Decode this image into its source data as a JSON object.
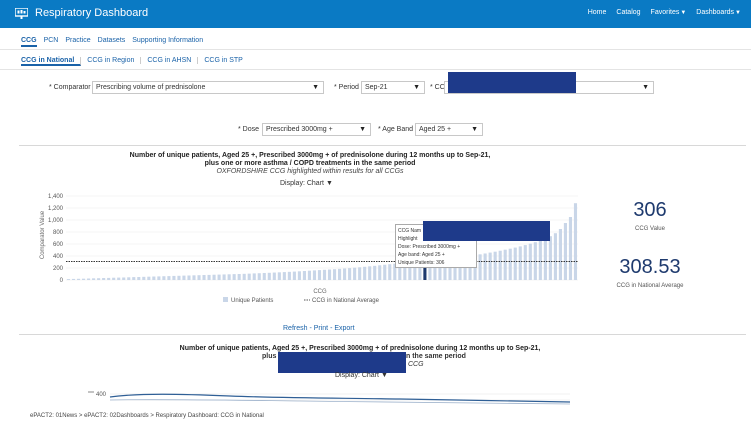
{
  "header": {
    "title": "Respiratory Dashboard",
    "nav": [
      "Home",
      "Catalog",
      "Favorites",
      "Dashboards"
    ]
  },
  "tabs": [
    "CCG",
    "PCN",
    "Practice",
    "Datasets",
    "Supporting Information"
  ],
  "subtabs": [
    "CCG in National",
    "CCG in Region",
    "CCG in AHSN",
    "CCG in STP"
  ],
  "filters": {
    "comparator_label": "* Comparator",
    "comparator_value": "Prescribing volume of prednisolone",
    "period_label": "* Period",
    "period_value": "Sep-21",
    "ccg_label": "* CC",
    "dose_label": "* Dose",
    "dose_value": "Prescribed 3000mg +",
    "age_label": "* Age Band",
    "age_value": "Aged 25 +"
  },
  "chart1": {
    "title_line1": "Number of unique patients, Aged 25 +, Prescribed 3000mg + of prednisolone during 12 months up to Sep-21,",
    "title_line2": "plus one or more asthma / COPD treatments in the same period",
    "subtitle": "OXFORDSHIRE CCG highlighted within results for all CCGs",
    "display_label": "Display:",
    "display_value": "Chart",
    "tooltip": {
      "line1": "CCG Nam",
      "line2": "Highlight",
      "line3": "Dose: Prescribed 3000mg +",
      "line4": "Age band: Aged 25 +",
      "line5": "Unique Patients: 306"
    },
    "links": "Refresh - Print - Export"
  },
  "kpis": {
    "ccg_value": "306",
    "ccg_value_label": "CCG Value",
    "national_avg": "308.53",
    "national_avg_label": "CCG in National Average"
  },
  "chart2": {
    "title_line1": "Number of unique patients, Aged 25 +, Prescribed 3000mg + of prednisolone during 12 months up to Sep-21,",
    "title_line2_left": "plus",
    "title_line2_right": "n the same period",
    "subtitle_right": "CCG",
    "display_label": "Display:",
    "display_value": "Chart",
    "tick_400": "400"
  },
  "breadcrumb": "ePACT2: 01News > ePACT2: 02Dashboards > Respiratory Dashboard: CCG in National",
  "chart_data": {
    "type": "bar",
    "title": "Number of unique patients, Aged 25 +, Prescribed 3000mg + of prednisolone during 12 months up to Sep-21, plus one or more asthma / COPD treatments in the same period",
    "xlabel": "CCG",
    "ylabel": "Comparator Value",
    "ylim": [
      0,
      1400
    ],
    "yticks": [
      "0",
      "200",
      "400",
      "600",
      "800",
      "1,000",
      "1,200",
      "1,400"
    ],
    "legend_placement": "bottom",
    "series": [
      {
        "name": "Unique Patients",
        "color": "#c9d6e8",
        "highlight_color": "#1e3a6e",
        "highlight_index": 71,
        "values": [
          15,
          18,
          20,
          22,
          25,
          28,
          30,
          33,
          35,
          38,
          40,
          42,
          45,
          48,
          50,
          53,
          55,
          58,
          60,
          63,
          65,
          68,
          70,
          73,
          75,
          78,
          80,
          83,
          85,
          88,
          90,
          93,
          95,
          98,
          100,
          103,
          106,
          110,
          113,
          117,
          120,
          124,
          128,
          132,
          136,
          140,
          145,
          150,
          155,
          160,
          165,
          170,
          175,
          180,
          186,
          192,
          198,
          205,
          212,
          220,
          228,
          236,
          245,
          254,
          263,
          272,
          281,
          290,
          298,
          302,
          304,
          306,
          315,
          325,
          335,
          345,
          355,
          366,
          378,
          390,
          402,
          415,
          428,
          442,
          457,
          472,
          488,
          505,
          522,
          540,
          560,
          582,
          605,
          630,
          658,
          690,
          730,
          780,
          850,
          950,
          1050,
          1280
        ]
      },
      {
        "name": "CCG in National Average",
        "type": "line",
        "value": 308.53
      }
    ]
  }
}
